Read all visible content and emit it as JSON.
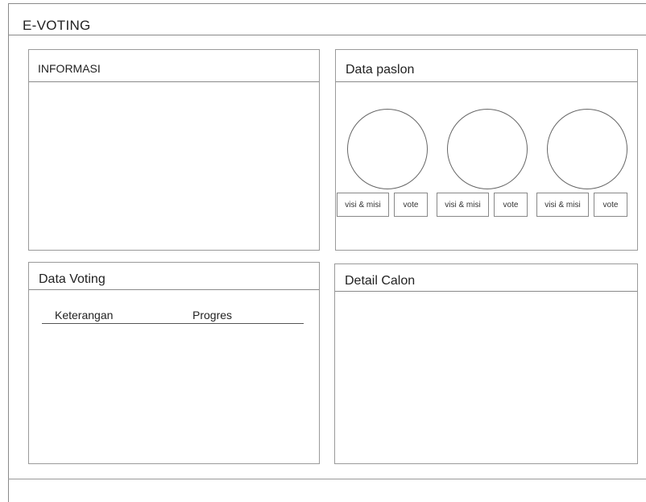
{
  "app": {
    "title": "E-VOTING"
  },
  "informasi": {
    "title": "INFORMASI"
  },
  "paslon": {
    "title": "Data paslon",
    "candidates": [
      {
        "visi_label": "visi & misi",
        "vote_label": "vote"
      },
      {
        "visi_label": "visi & misi",
        "vote_label": "vote"
      },
      {
        "visi_label": "visi & misi",
        "vote_label": "vote"
      }
    ]
  },
  "voting": {
    "title": "Data Voting",
    "columns": [
      "Keterangan",
      "Progres"
    ]
  },
  "detail": {
    "title": "Detail Calon"
  }
}
